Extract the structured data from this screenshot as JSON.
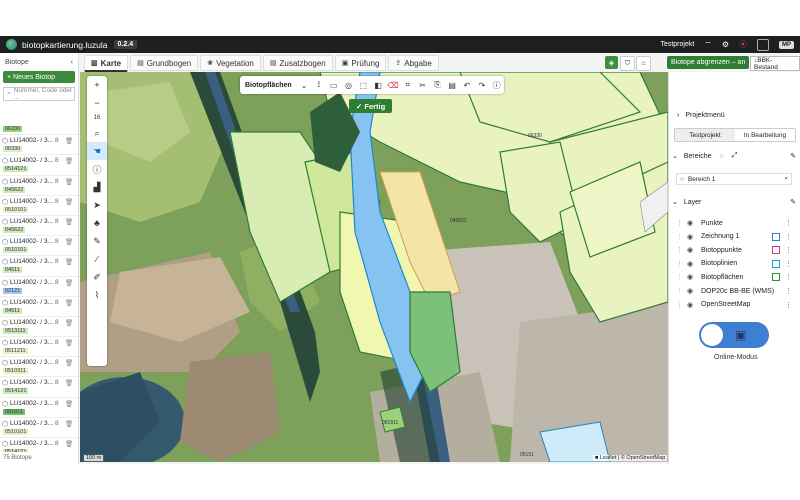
{
  "app": {
    "title": "biotopkartierung.luzula",
    "version": "0.2.4",
    "project": "Testprojekt",
    "user": "MP"
  },
  "left": {
    "header": "Biotope",
    "new_button": "+ Neues Biotop",
    "search_placeholder": "Nummer, Code oder ...",
    "items": [
      {
        "title": "",
        "count": "",
        "code": "06330",
        "color": "#9ad17a"
      },
      {
        "title": "LU14002- / 3...",
        "count": "8",
        "code": "06330",
        "color": "#d8ecc8"
      },
      {
        "title": "LU14002- / 3...",
        "count": "8",
        "code": "0514121",
        "color": "#cfe8b8"
      },
      {
        "title": "LU14002- / 3...",
        "count": "8",
        "code": "045622",
        "color": "#cfe8b8"
      },
      {
        "title": "LU14002- / 3...",
        "count": "8",
        "code": "0510101",
        "color": "#e2f2c8"
      },
      {
        "title": "LU14002- / 3...",
        "count": "8",
        "code": "045622",
        "color": "#cfe8b8"
      },
      {
        "title": "LU14002- / 3...",
        "count": "8",
        "code": "0510101",
        "color": "#d8ecc8"
      },
      {
        "title": "LU14002- / 3...",
        "count": "8",
        "code": "04511",
        "color": "#cfe8b8"
      },
      {
        "title": "LU14002- / 3...",
        "count": "8",
        "code": "02121",
        "color": "#9ec8f0"
      },
      {
        "title": "LU14002- / 3...",
        "count": "8",
        "code": "04511",
        "color": "#cfe8b8"
      },
      {
        "title": "LU14002- / 3...",
        "count": "8",
        "code": "0513111",
        "color": "#cfe8b8"
      },
      {
        "title": "LU14002- / 3...",
        "count": "8",
        "code": "0511211",
        "color": "#e2f2c8"
      },
      {
        "title": "LU14002- / 3...",
        "count": "8",
        "code": "0510311",
        "color": "#e2f2c8"
      },
      {
        "title": "LU14002- / 3...",
        "count": "8",
        "code": "0514121",
        "color": "#cfe8b8"
      },
      {
        "title": "LU14002- / 3...",
        "count": "8",
        "code": "081811",
        "color": "#6fbf6f"
      },
      {
        "title": "LU14002- / 3...",
        "count": "8",
        "code": "0510101",
        "color": "#e2f2c8"
      },
      {
        "title": "LU14002- / 3...",
        "count": "8",
        "code": "0514121",
        "color": "#cfe8b8"
      }
    ],
    "footer": "75 Biotope"
  },
  "tabs": [
    {
      "label": "Karte",
      "icon": "map-icon",
      "glyph": "▥",
      "active": true
    },
    {
      "label": "Grundbogen",
      "icon": "document-icon",
      "glyph": "▤",
      "active": false
    },
    {
      "label": "Vegetation",
      "icon": "leaf-icon",
      "glyph": "❀",
      "active": false
    },
    {
      "label": "Zusatzbogen",
      "icon": "document-icon",
      "glyph": "▤",
      "active": false
    },
    {
      "label": "Prüfung",
      "icon": "clipboard-icon",
      "glyph": "▣",
      "active": false
    },
    {
      "label": "Abgabe",
      "icon": "upload-icon",
      "glyph": "⇪",
      "active": false
    }
  ],
  "toolbar_right": {
    "abgrenzen": "Biotope abgrenzen – an",
    "bbk": "↓BBK-Bestand"
  },
  "map": {
    "layer_select": "Biotopflächen",
    "done_button": "✓ Fertig",
    "zoom_level": "16",
    "scale": "100 m",
    "attribution": "■ Leaflet | © OpenStreetMap",
    "labels": [
      "06330",
      "045622",
      "081811",
      "05151"
    ]
  },
  "right": {
    "menu": "Projektmenü",
    "seg_a": "Testprojekt",
    "seg_b": "In Bearbeitung",
    "bereiche": "Bereiche",
    "bereich1": "Bereich 1",
    "layer_title": "Layer",
    "layers": [
      {
        "name": "Punkte",
        "color": ""
      },
      {
        "name": "Zeichnung 1",
        "color": "#2a7de1"
      },
      {
        "name": "Biotoppunkte",
        "color": "#d43b8a"
      },
      {
        "name": "Biotoplinien",
        "color": "#1aa3c9"
      },
      {
        "name": "Biotopflächen",
        "color": "#2e8b3a"
      },
      {
        "name": "DOP20c BB-BE (WMS)",
        "color": ""
      },
      {
        "name": "OpenStreetMap",
        "color": ""
      }
    ],
    "wms_tag": "(WMS)",
    "online": "Online-Modus"
  }
}
